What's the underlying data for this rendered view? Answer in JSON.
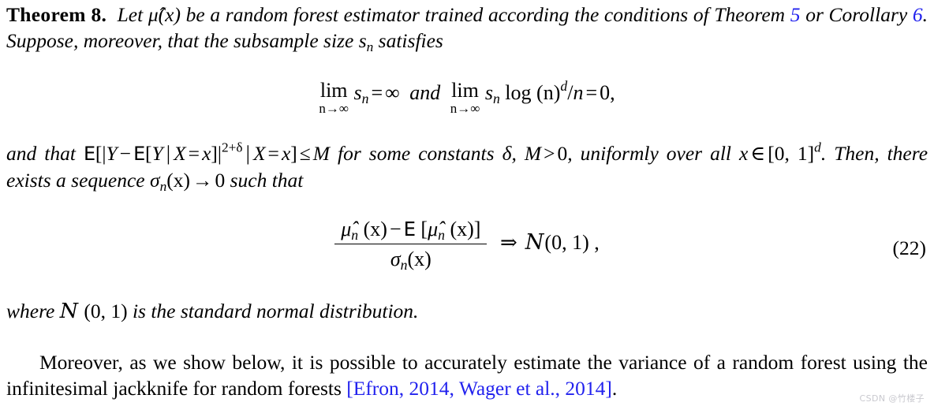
{
  "document": {
    "theorem": {
      "label": "Theorem",
      "number": "8.",
      "body_part1": "Let ",
      "mu_hat_x": "μ̂(x)",
      "body_part2": " be a random forest estimator trained according the conditions of Theorem ",
      "ref_theorem": "5",
      "body_part3": " or Corollary ",
      "ref_corollary": "6",
      "body_part4": ". Suppose, moreover, that the subsample size ",
      "s_n": "s",
      "s_n_sub": "n",
      "body_part5": " satisfies"
    },
    "equation_limits": {
      "lim1_main": "lim",
      "lim1_sub": "n→∞",
      "lim1_body_s": "s",
      "lim1_body_sub": "n",
      "lim1_eq": "=",
      "lim1_rhs": "∞",
      "conjunction": "and",
      "lim2_main": "lim",
      "lim2_sub": "n→∞",
      "lim2_s": "s",
      "lim2_s_sub": "n",
      "lim2_log": "log",
      "lim2_paren_n": "(n)",
      "lim2_exp": "d",
      "lim2_slash": "/",
      "lim2_denom": "n",
      "lim2_eq": "=",
      "lim2_rhs": "0,"
    },
    "condition": {
      "lead": "and that ",
      "E1": "E",
      "br_open": "[|",
      "Y1": "Y",
      "minus": "−",
      "E2": "E",
      "br2": "[",
      "Y2": "Y",
      "mid1": "|",
      "X1": "X",
      "eq1": "=",
      "x1": "x",
      "close1": "]|",
      "exp": "2+δ",
      "mid2": "|",
      "X2": "X",
      "eq2": "=",
      "x2": "x",
      "close2": "]",
      "leq": "≤",
      "M": "M",
      "tail1": " for some constants ",
      "delta": "δ",
      "comma": ", ",
      "M2": "M",
      "gt": ">",
      "zero": "0",
      "tail2": ", uniformly over all ",
      "x3": "x",
      "in": "∈",
      "interval": "[0, 1]",
      "interval_exp": "d",
      "tail3": ". Then, there exists a sequence ",
      "sigma": "σ",
      "sigma_sub": "n",
      "sigma_arg": "(x)",
      "arrow": "→",
      "zero2": "0",
      "tail4": " such that"
    },
    "equation_clt": {
      "num_mu1": "μ̂",
      "num_mu1_sub": "n",
      "num_arg1": "(x)",
      "num_minus": "−",
      "num_E": "E",
      "num_br_open": "[",
      "num_mu2": "μ̂",
      "num_mu2_sub": "n",
      "num_arg2": "(x)",
      "num_br_close": "]",
      "den_sigma": "σ",
      "den_sigma_sub": "n",
      "den_arg": "(x)",
      "implies": "⇒",
      "normal_symbol": "Ν",
      "normal_args": "(0, 1) ,",
      "number": "(22)"
    },
    "where_line": {
      "lead": "where ",
      "normal_symbol": "Ν",
      "normal_args": " (0, 1) ",
      "tail": "is the standard normal distribution."
    },
    "closing": {
      "indent_text": "Moreover, as we show below, it is possible to accurately estimate the variance of a random forest using the infinitesimal jackknife for random forests ",
      "citation": "[Efron, 2014, Wager et al., 2014]",
      "period": "."
    },
    "watermark": "CSDN @竹楼子",
    "colors": {
      "link": "#2222ee",
      "text": "#000000",
      "background": "#ffffff",
      "watermark": "#c9c9cf"
    }
  }
}
